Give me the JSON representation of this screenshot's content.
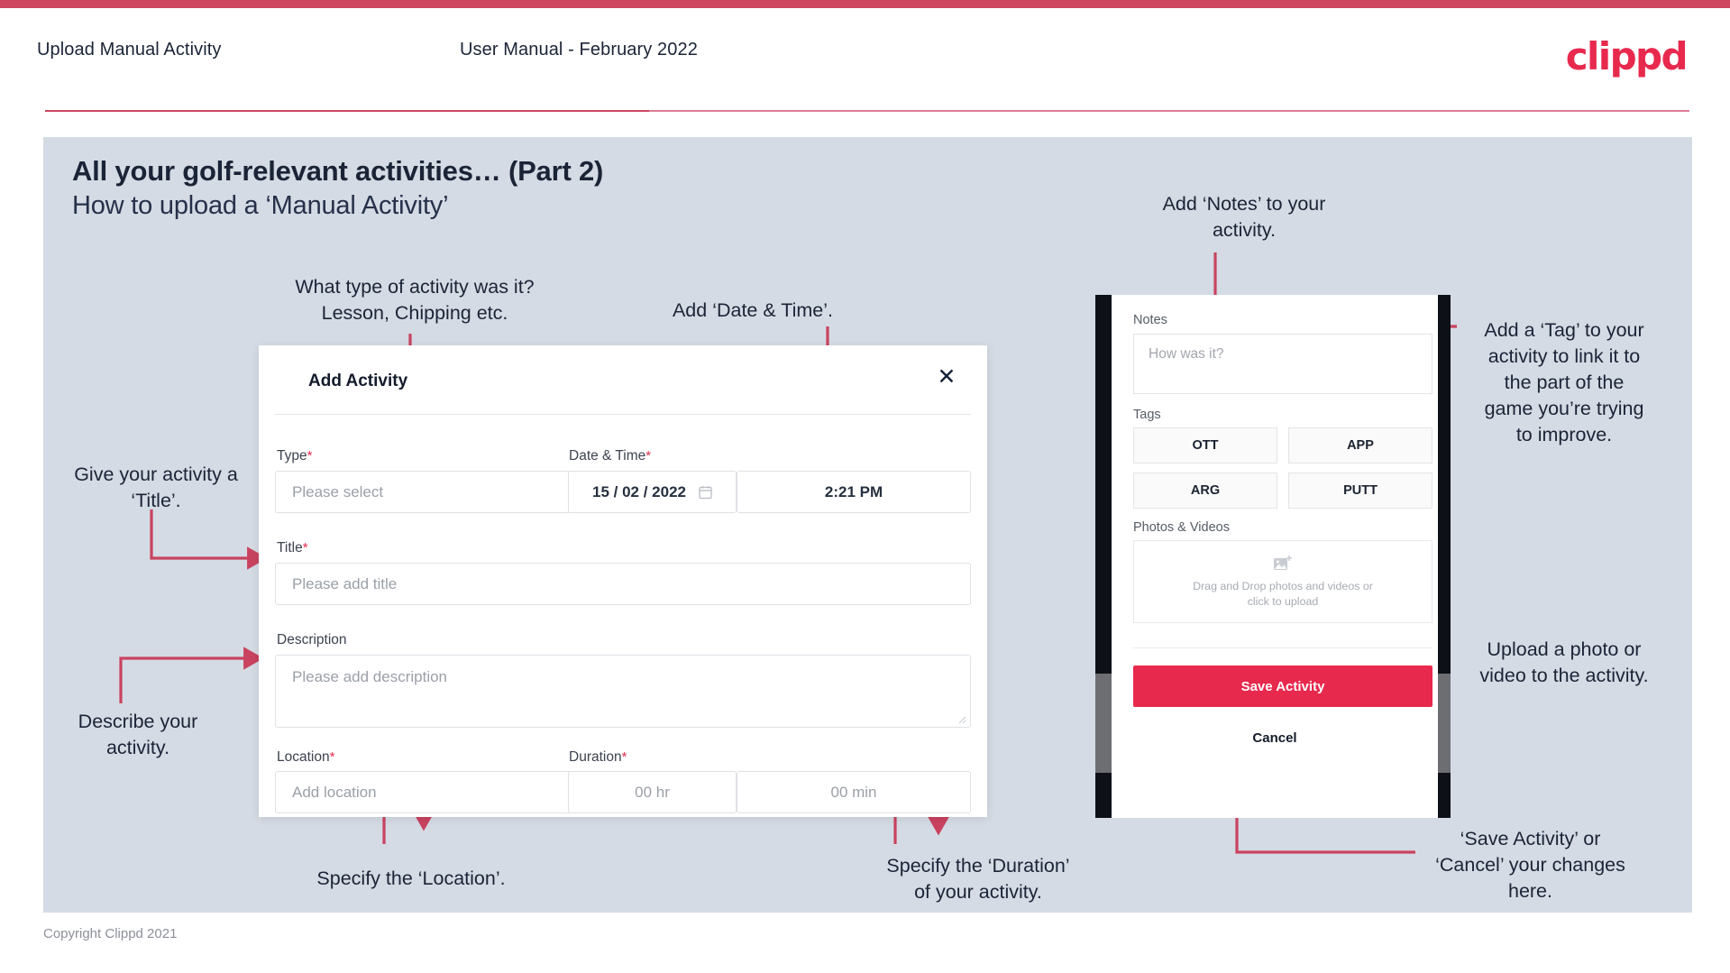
{
  "header": {
    "left_title": "Upload Manual Activity",
    "center_title": "User Manual - February 2022",
    "logo": "clippd"
  },
  "slide": {
    "title_main": "All your golf-relevant activities… (Part 2)",
    "title_sub": "How to upload a ‘Manual Activity’"
  },
  "annotations": {
    "type": "What type of activity was it?\nLesson, Chipping etc.",
    "date_time": "Add ‘Date & Time’.",
    "title": "Give your activity a\n‘Title’.",
    "description": "Describe your\nactivity.",
    "location": "Specify the ‘Location’.",
    "duration": "Specify the ‘Duration’\nof your activity.",
    "notes": "Add ‘Notes’ to your\nactivity.",
    "tags": "Add a ‘Tag’ to your\nactivity to link it to\nthe part of the\ngame you’re trying\nto improve.",
    "photos": "Upload a photo or\nvideo to the activity.",
    "save_cancel": "‘Save Activity’ or\n‘Cancel’ your changes\nhere."
  },
  "dialog": {
    "title": "Add Activity",
    "close_icon": "close-icon",
    "fields": {
      "type": {
        "label": "Type",
        "required": "*",
        "placeholder": "Please select"
      },
      "datetime": {
        "label": "Date & Time",
        "required": "*",
        "date": "15 / 02 / 2022",
        "time": "2:21 PM"
      },
      "title": {
        "label": "Title",
        "required": "*",
        "placeholder": "Please add title"
      },
      "description": {
        "label": "Description",
        "required": "",
        "placeholder": "Please add description"
      },
      "location": {
        "label": "Location",
        "required": "*",
        "placeholder": "Add location"
      },
      "duration": {
        "label": "Duration",
        "required": "*",
        "hours": "00 hr",
        "minutes": "00 min"
      }
    }
  },
  "mobile": {
    "notes_label": "Notes",
    "notes_placeholder": "How was it?",
    "tags_label": "Tags",
    "tags": [
      "OTT",
      "APP",
      "ARG",
      "PUTT"
    ],
    "photos_label": "Photos & Videos",
    "dropzone_text": "Drag and Drop photos and videos or\nclick to upload",
    "dropzone_icon": "add-image-icon",
    "save_label": "Save Activity",
    "cancel_label": "Cancel"
  },
  "footer": {
    "copyright": "Copyright Clippd 2021"
  },
  "colors": {
    "brand_pink": "#e8294e",
    "header_bar": "#cf4661",
    "slide_bg": "#d5dbe4",
    "arrow": "#c94360",
    "text_dark": "#1b2437"
  }
}
